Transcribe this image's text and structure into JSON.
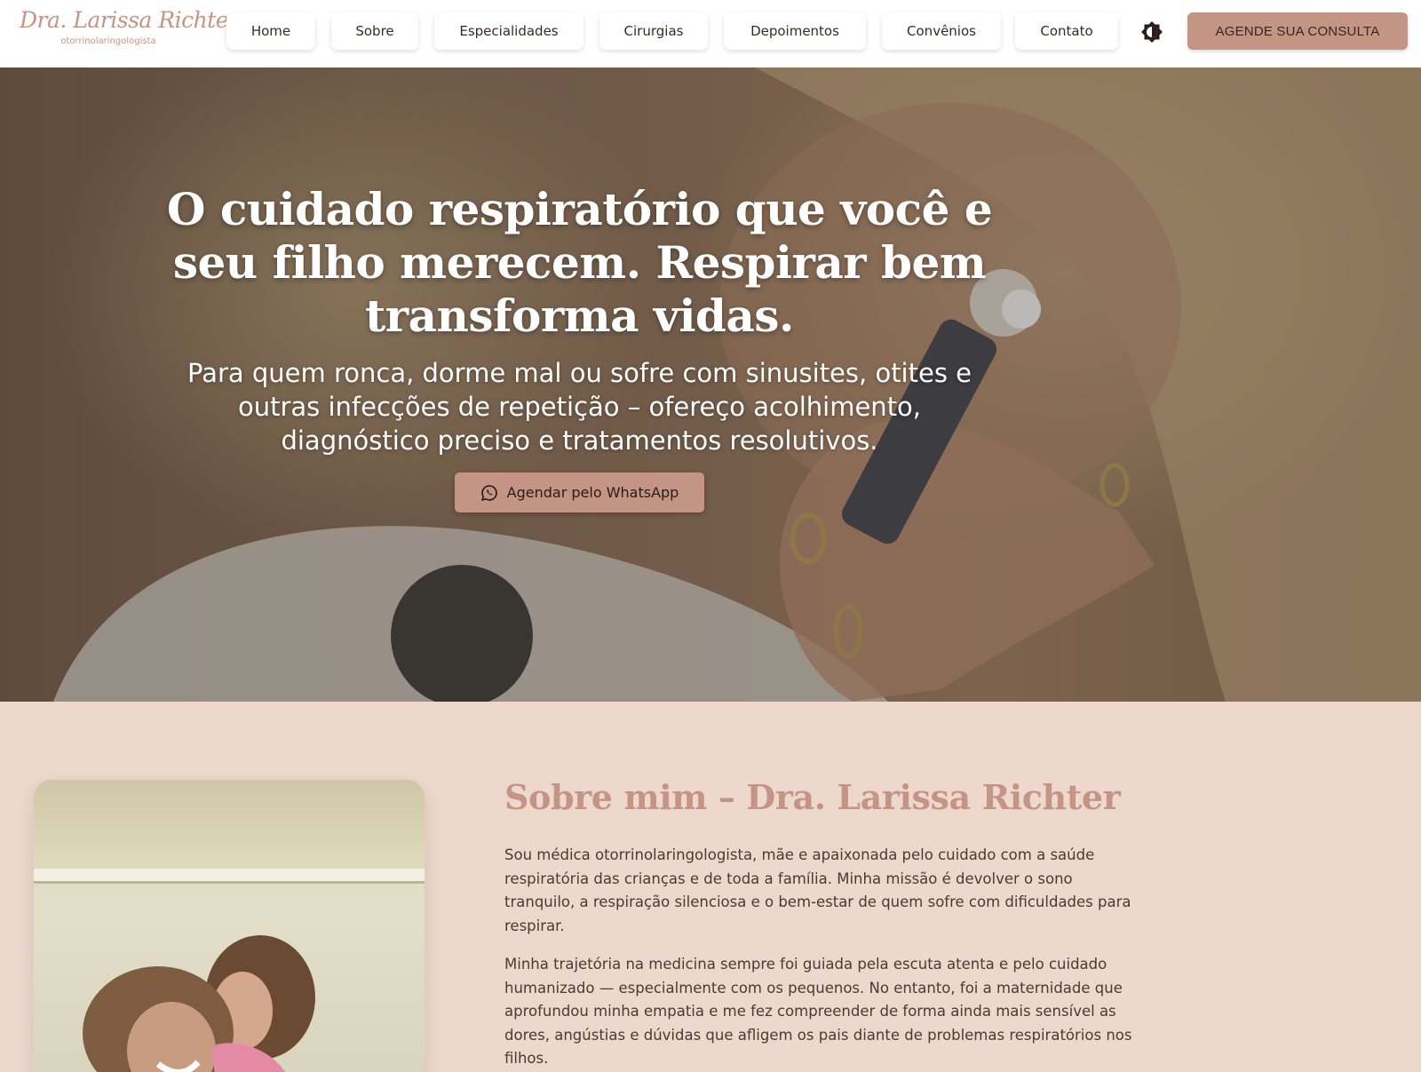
{
  "header": {
    "logo": {
      "name": "Dra. Larissa Richter",
      "subtitle": "otorrinolaringologista"
    },
    "nav": [
      {
        "label": "Home"
      },
      {
        "label": "Sobre"
      },
      {
        "label": "Especialidades"
      },
      {
        "label": "Cirurgias"
      },
      {
        "label": "Depoimentos"
      },
      {
        "label": "Convênios"
      },
      {
        "label": "Contato"
      }
    ],
    "theme_toggle_icon": "half-sun-icon",
    "cta_label": "AGENDE SUA CONSULTA"
  },
  "hero": {
    "title": "O cuidado respiratório que você e seu filho merecem. Respirar bem transforma vidas.",
    "subtitle": "Para quem ronca, dorme mal ou sofre com sinusites, otites e outras infecções de repetição – ofereço acolhimento, diagnóstico preciso e tratamentos resolutivos.",
    "button_label": "Agendar pelo WhatsApp",
    "button_icon": "whatsapp-icon"
  },
  "about": {
    "title": "Sobre mim – Dra. Larissa Richter",
    "paragraphs": [
      "Sou médica otorrinolaringologista, mãe e apaixonada pelo cuidado com a saúde respiratória das crianças e de toda a família. Minha missão é devolver o sono tranquilo, a respiração silenciosa e o bem-estar de quem sofre com dificuldades para respirar.",
      "Minha trajetória na medicina sempre foi guiada pela escuta atenta e pelo cuidado humanizado — especialmente com os pequenos. No entanto, foi a maternidade que aprofundou minha empatia e me fez compreender de forma ainda mais sensível as dores, angústias e dúvidas que afligem os pais diante de problemas respiratórios nos filhos."
    ]
  },
  "colors": {
    "accent": "#c49585",
    "page_background": "#eed8cd",
    "header_background": "#ffffff",
    "text_dark": "#3a2a24"
  }
}
